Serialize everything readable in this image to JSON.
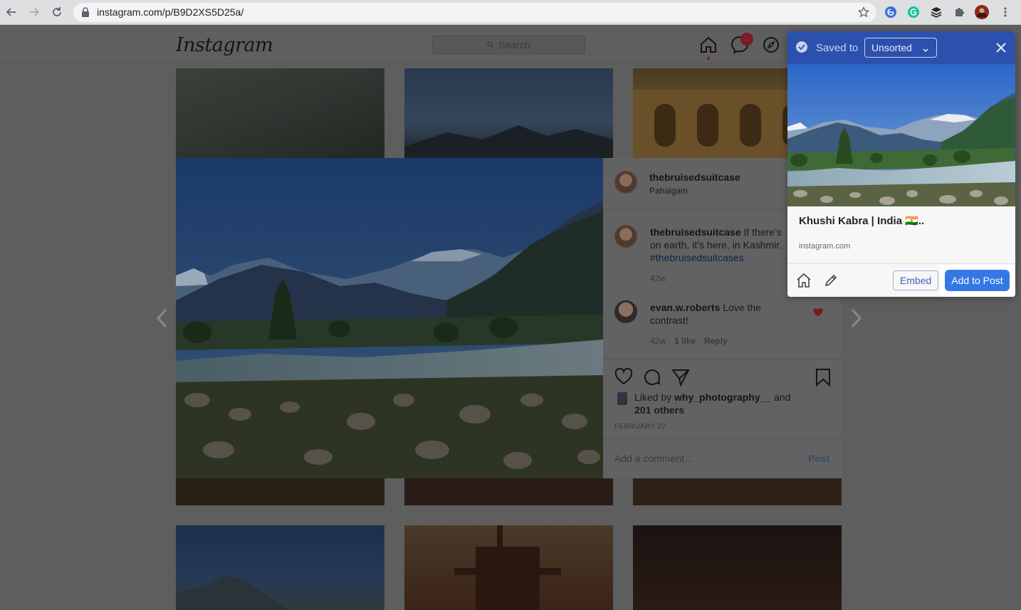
{
  "browser": {
    "url": "instagram.com/p/B9D2XS5D25a/"
  },
  "instagram": {
    "logo": "Instagram",
    "search_placeholder": "Search",
    "messages_badge": "2"
  },
  "post": {
    "author": "thebruisedsuitcase",
    "location": "Pahalgam",
    "caption_user": "thebruisedsuitcase",
    "caption_line1": "If there’s",
    "caption_line2": "on earth, it’s here, in Kashmir.",
    "hashtag": "#thebruisedsuitcases",
    "caption_age": "42w",
    "comment": {
      "user": "evan.w.roberts",
      "text_line1": "Love the",
      "text_line2": "contrast!",
      "age": "42w",
      "likes": "1 like",
      "reply": "Reply"
    },
    "liked_by_prefix": "Liked by",
    "liked_by_user": "why_photography__",
    "liked_by_and": "and",
    "liked_by_others": "201 others",
    "date": "FEBRUARY 27",
    "comment_placeholder": "Add a comment...",
    "post_button": "Post"
  },
  "popup": {
    "saved_to": "Saved to",
    "collection": "Unsorted",
    "title": "Khushi Kabra | India 🇮🇳..",
    "site": "instagram.com",
    "embed_label": "Embed",
    "add_label": "Add to Post",
    "accent_color": "#2c50ad",
    "button_color": "#3478e6"
  }
}
